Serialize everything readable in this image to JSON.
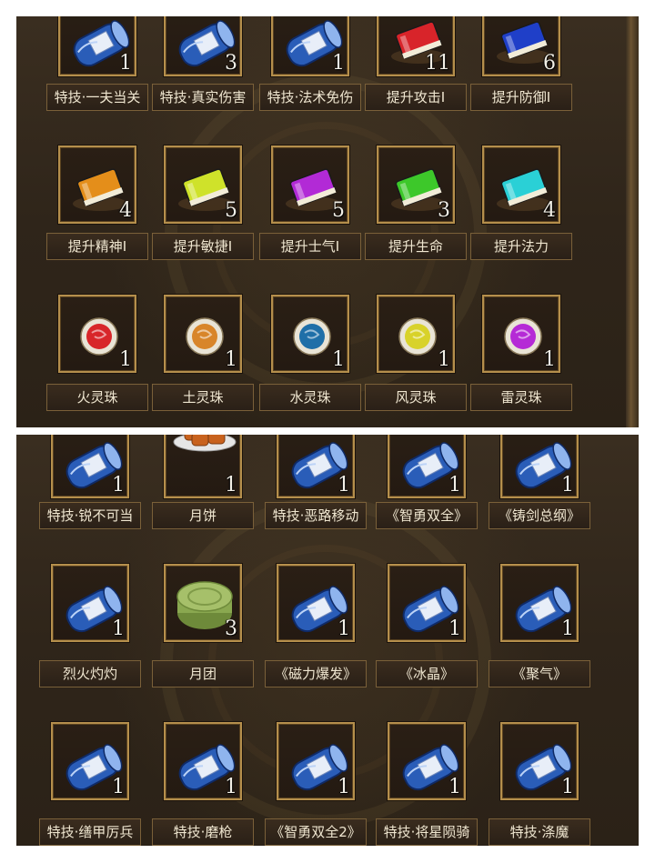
{
  "colors": {
    "scroll_blue": "#2a5db8",
    "book_red": "#d8242a",
    "book_blue": "#1f3fc8",
    "book_orange": "#e48e1a",
    "book_yellow": "#cfe22a",
    "book_purple": "#b22ad6",
    "book_green": "#3dc82a",
    "book_cyan": "#2ad0d6",
    "orb_red": "#d8262a",
    "orb_orange": "#d8852a",
    "orb_teal": "#1f6fa8",
    "orb_yellow": "#d8d22a",
    "orb_purple": "#b52ad6",
    "frame_gold": "#b58f4c",
    "panel_bg": "#2f251a"
  },
  "panel_top": {
    "rows": [
      [
        {
          "label": "特技·一夫当关",
          "count": "1",
          "icon": "blue-scroll-icon"
        },
        {
          "label": "特技·真实伤害",
          "count": "3",
          "icon": "blue-scroll-icon"
        },
        {
          "label": "特技·法术免伤",
          "count": "1",
          "icon": "blue-scroll-icon"
        },
        {
          "label": "提升攻击Ⅰ",
          "count": "11",
          "icon": "red-book-icon"
        },
        {
          "label": "提升防御Ⅰ",
          "count": "6",
          "icon": "blue-book-icon"
        }
      ],
      [
        {
          "label": "提升精神Ⅰ",
          "count": "4",
          "icon": "orange-book-icon"
        },
        {
          "label": "提升敏捷Ⅰ",
          "count": "5",
          "icon": "yellow-book-icon"
        },
        {
          "label": "提升士气Ⅰ",
          "count": "5",
          "icon": "purple-book-icon"
        },
        {
          "label": "提升生命",
          "count": "3",
          "icon": "green-book-icon"
        },
        {
          "label": "提升法力",
          "count": "4",
          "icon": "cyan-book-icon"
        }
      ],
      [
        {
          "label": "火灵珠",
          "count": "1",
          "icon": "red-orb-icon"
        },
        {
          "label": "土灵珠",
          "count": "1",
          "icon": "orange-orb-icon"
        },
        {
          "label": "水灵珠",
          "count": "1",
          "icon": "teal-orb-icon"
        },
        {
          "label": "风灵珠",
          "count": "1",
          "icon": "yellow-orb-icon"
        },
        {
          "label": "雷灵珠",
          "count": "1",
          "icon": "purple-orb-icon"
        }
      ]
    ]
  },
  "panel_bottom": {
    "rows": [
      [
        {
          "label": "特技·锐不可当",
          "count": "1",
          "icon": "blue-scroll-icon"
        },
        {
          "label": "月饼",
          "count": "1",
          "icon": "mooncake-plate-icon"
        },
        {
          "label": "特技·恶路移动",
          "count": "1",
          "icon": "blue-scroll-icon"
        },
        {
          "label": "《智勇双全》",
          "count": "1",
          "icon": "blue-scroll-icon"
        },
        {
          "label": "《铸剑总纲》",
          "count": "1",
          "icon": "blue-scroll-icon"
        }
      ],
      [
        {
          "label": "烈火灼灼",
          "count": "1",
          "icon": "blue-scroll-icon"
        },
        {
          "label": "月团",
          "count": "3",
          "icon": "green-mooncake-icon"
        },
        {
          "label": "《磁力爆发》",
          "count": "1",
          "icon": "blue-scroll-icon"
        },
        {
          "label": "《冰晶》",
          "count": "1",
          "icon": "blue-scroll-icon"
        },
        {
          "label": "《聚气》",
          "count": "1",
          "icon": "blue-scroll-icon"
        }
      ],
      [
        {
          "label": "特技·缮甲厉兵",
          "count": "1",
          "icon": "blue-scroll-icon"
        },
        {
          "label": "特技·磨枪",
          "count": "1",
          "icon": "blue-scroll-icon"
        },
        {
          "label": "《智勇双全2》",
          "count": "1",
          "icon": "blue-scroll-icon"
        },
        {
          "label": "特技·将星陨骑",
          "count": "1",
          "icon": "blue-scroll-icon"
        },
        {
          "label": "特技·涤魔",
          "count": "1",
          "icon": "blue-scroll-icon"
        }
      ]
    ]
  }
}
